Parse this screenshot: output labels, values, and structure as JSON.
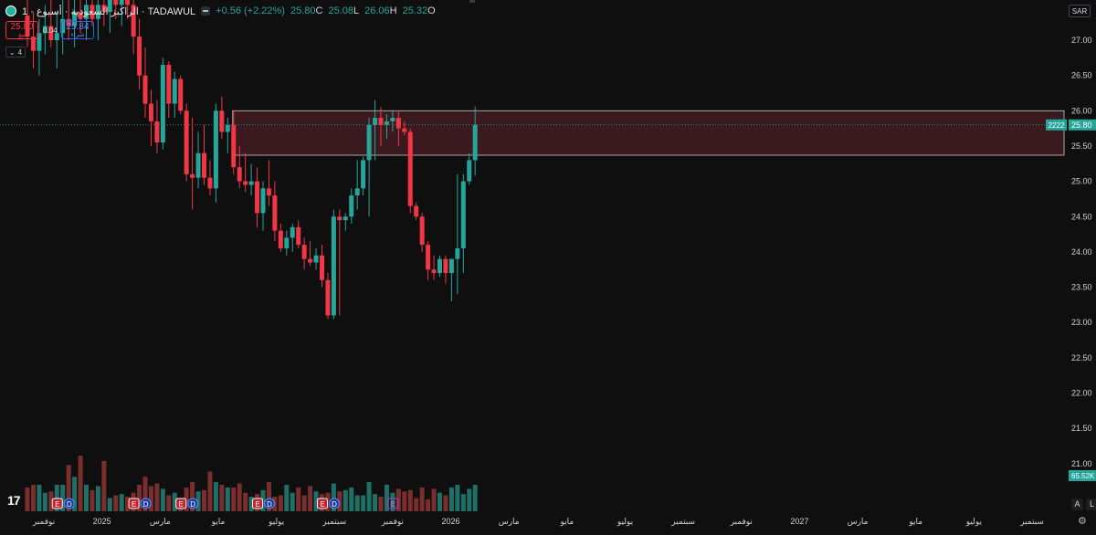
{
  "header": {
    "title": "الراكبز السعودية · أسبوع · 1 · TADAWUL",
    "change": "+0.56 (+2.22%)",
    "ohlc": [
      {
        "label": "O",
        "value": "25.32"
      },
      {
        "label": "H",
        "value": "26.06"
      },
      {
        "label": "L",
        "value": "25.08"
      },
      {
        "label": "C",
        "value": "25.80"
      }
    ]
  },
  "trade": {
    "sell_price": "25.80",
    "sell_label": "بيع",
    "buy_price": "25.84",
    "buy_label": "شراء",
    "spread": "0.04",
    "lots": "4"
  },
  "currency": "SAR",
  "bottom_buttons": {
    "auto": "A",
    "log": "L"
  },
  "colors": {
    "background": "#0f0f0f",
    "up": "#26a69a",
    "down": "#f23645",
    "up_volume": "#1f6f67",
    "down_volume": "#7a2e2e",
    "zone_fill": "#3a1a1e",
    "zone_border": "#c9c9c9",
    "current_price": "#26a69a"
  },
  "chart_data": {
    "type": "candlestick",
    "interval": "1 week",
    "y_axis": {
      "side": "right",
      "ticks": [
        "27.00",
        "26.50",
        "26.00",
        "25.50",
        "25.00",
        "24.50",
        "24.00",
        "23.50",
        "23.00",
        "22.50",
        "22.00",
        "21.50",
        "21.00"
      ],
      "range": [
        20.68,
        27.3
      ]
    },
    "x_axis_labels": [
      "نوفمبر",
      "2025",
      "مارس",
      "مايو",
      "يوليو",
      "سبتمبر",
      "نوفمبر",
      "2026",
      "مارس",
      "مايو",
      "يوليو",
      "سبتمبر",
      "نوفمبر",
      "2027",
      "مارس",
      "مايو",
      "يوليو",
      "سبتمبر"
    ],
    "current_price": "25.80",
    "countdown_badge": "2222",
    "last_volume_label": "65.52K",
    "resistance_zone": {
      "top": 26.0,
      "bottom": 25.37,
      "start_index": 35
    },
    "event_markers": [
      {
        "index": 5,
        "labels": [
          "E",
          "D"
        ]
      },
      {
        "index": 18,
        "labels": [
          "E",
          "D"
        ]
      },
      {
        "index": 26,
        "labels": [
          "E",
          "D"
        ]
      },
      {
        "index": 39,
        "labels": [
          "E",
          "D"
        ]
      },
      {
        "index": 50,
        "labels": [
          "E",
          "D"
        ]
      },
      {
        "index": 62,
        "labels": [
          "E"
        ]
      }
    ],
    "candles": [
      {
        "o": 27.35,
        "h": 27.6,
        "l": 26.9,
        "c": 27.05,
        "v": 0.18
      },
      {
        "o": 27.05,
        "h": 27.4,
        "l": 26.6,
        "c": 26.85,
        "v": 0.2
      },
      {
        "o": 26.85,
        "h": 27.3,
        "l": 26.5,
        "c": 27.1,
        "v": 0.2
      },
      {
        "o": 27.1,
        "h": 27.5,
        "l": 26.8,
        "c": 27.2,
        "v": 0.14
      },
      {
        "o": 27.2,
        "h": 27.6,
        "l": 26.9,
        "c": 27.0,
        "v": 0.15
      },
      {
        "o": 27.0,
        "h": 27.4,
        "l": 26.6,
        "c": 27.1,
        "v": 0.2
      },
      {
        "o": 27.1,
        "h": 27.6,
        "l": 26.8,
        "c": 27.3,
        "v": 0.2
      },
      {
        "o": 27.3,
        "h": 27.8,
        "l": 27.0,
        "c": 27.2,
        "v": 0.35
      },
      {
        "o": 27.2,
        "h": 27.6,
        "l": 26.9,
        "c": 27.4,
        "v": 0.26
      },
      {
        "o": 27.4,
        "h": 27.8,
        "l": 27.1,
        "c": 27.3,
        "v": 0.42
      },
      {
        "o": 27.3,
        "h": 27.7,
        "l": 27.0,
        "c": 27.5,
        "v": 0.2
      },
      {
        "o": 27.5,
        "h": 27.9,
        "l": 27.2,
        "c": 27.3,
        "v": 0.16
      },
      {
        "o": 27.3,
        "h": 27.7,
        "l": 27.0,
        "c": 27.5,
        "v": 0.19
      },
      {
        "o": 27.5,
        "h": 27.9,
        "l": 27.2,
        "c": 27.4,
        "v": 0.38
      },
      {
        "o": 27.4,
        "h": 27.8,
        "l": 27.1,
        "c": 27.6,
        "v": 0.1
      },
      {
        "o": 27.6,
        "h": 28.0,
        "l": 27.3,
        "c": 27.5,
        "v": 0.12
      },
      {
        "o": 27.5,
        "h": 27.9,
        "l": 27.2,
        "c": 27.7,
        "v": 0.13
      },
      {
        "o": 27.7,
        "h": 28.0,
        "l": 27.3,
        "c": 27.5,
        "v": 0.11
      },
      {
        "o": 27.5,
        "h": 27.9,
        "l": 26.8,
        "c": 27.05,
        "v": 0.14
      },
      {
        "o": 27.05,
        "h": 27.3,
        "l": 26.3,
        "c": 26.5,
        "v": 0.2
      },
      {
        "o": 26.5,
        "h": 26.9,
        "l": 25.9,
        "c": 26.1,
        "v": 0.26
      },
      {
        "o": 26.1,
        "h": 26.3,
        "l": 25.5,
        "c": 25.85,
        "v": 0.19
      },
      {
        "o": 25.85,
        "h": 26.15,
        "l": 25.4,
        "c": 25.55,
        "v": 0.21
      },
      {
        "o": 25.55,
        "h": 26.75,
        "l": 25.45,
        "c": 26.65,
        "v": 0.17
      },
      {
        "o": 26.65,
        "h": 26.7,
        "l": 25.9,
        "c": 26.1,
        "v": 0.12
      },
      {
        "o": 26.1,
        "h": 26.55,
        "l": 25.9,
        "c": 26.45,
        "v": 0.14
      },
      {
        "o": 26.45,
        "h": 26.5,
        "l": 25.95,
        "c": 26.0,
        "v": 0.08
      },
      {
        "o": 26.0,
        "h": 26.1,
        "l": 25.0,
        "c": 25.1,
        "v": 0.18
      },
      {
        "o": 25.1,
        "h": 25.9,
        "l": 24.6,
        "c": 25.05,
        "v": 0.22
      },
      {
        "o": 25.05,
        "h": 25.7,
        "l": 24.9,
        "c": 25.4,
        "v": 0.15
      },
      {
        "o": 25.4,
        "h": 25.8,
        "l": 24.95,
        "c": 25.05,
        "v": 0.16
      },
      {
        "o": 25.05,
        "h": 25.3,
        "l": 24.8,
        "c": 24.9,
        "v": 0.3
      },
      {
        "o": 24.9,
        "h": 26.1,
        "l": 24.7,
        "c": 26.0,
        "v": 0.22
      },
      {
        "o": 26.0,
        "h": 26.2,
        "l": 25.6,
        "c": 25.7,
        "v": 0.2
      },
      {
        "o": 25.7,
        "h": 25.9,
        "l": 25.4,
        "c": 25.8,
        "v": 0.18
      },
      {
        "o": 25.8,
        "h": 26.0,
        "l": 25.1,
        "c": 25.2,
        "v": 0.18
      },
      {
        "o": 25.2,
        "h": 25.5,
        "l": 24.9,
        "c": 25.0,
        "v": 0.21
      },
      {
        "o": 25.0,
        "h": 25.4,
        "l": 24.85,
        "c": 24.95,
        "v": 0.14
      },
      {
        "o": 24.95,
        "h": 25.25,
        "l": 24.8,
        "c": 25.0,
        "v": 0.11
      },
      {
        "o": 25.0,
        "h": 25.2,
        "l": 24.35,
        "c": 24.55,
        "v": 0.13
      },
      {
        "o": 24.55,
        "h": 25.0,
        "l": 24.3,
        "c": 24.9,
        "v": 0.16
      },
      {
        "o": 24.9,
        "h": 25.3,
        "l": 24.65,
        "c": 24.8,
        "v": 0.22
      },
      {
        "o": 24.8,
        "h": 25.0,
        "l": 24.15,
        "c": 24.3,
        "v": 0.11
      },
      {
        "o": 24.3,
        "h": 24.4,
        "l": 24.0,
        "c": 24.05,
        "v": 0.12
      },
      {
        "o": 24.05,
        "h": 24.3,
        "l": 23.95,
        "c": 24.2,
        "v": 0.2
      },
      {
        "o": 24.2,
        "h": 24.4,
        "l": 24.0,
        "c": 24.35,
        "v": 0.14
      },
      {
        "o": 24.35,
        "h": 24.45,
        "l": 24.05,
        "c": 24.1,
        "v": 0.18
      },
      {
        "o": 24.1,
        "h": 24.2,
        "l": 23.75,
        "c": 23.9,
        "v": 0.12
      },
      {
        "o": 23.9,
        "h": 24.15,
        "l": 23.8,
        "c": 23.85,
        "v": 0.19
      },
      {
        "o": 23.85,
        "h": 24.05,
        "l": 23.75,
        "c": 23.95,
        "v": 0.15
      },
      {
        "o": 23.95,
        "h": 24.1,
        "l": 23.5,
        "c": 23.6,
        "v": 0.13
      },
      {
        "o": 23.6,
        "h": 23.7,
        "l": 23.05,
        "c": 23.1,
        "v": 0.14
      },
      {
        "o": 23.1,
        "h": 24.6,
        "l": 23.05,
        "c": 24.5,
        "v": 0.21
      },
      {
        "o": 24.5,
        "h": 24.6,
        "l": 23.1,
        "c": 24.45,
        "v": 0.15
      },
      {
        "o": 24.45,
        "h": 24.55,
        "l": 24.3,
        "c": 24.5,
        "v": 0.16
      },
      {
        "o": 24.5,
        "h": 24.9,
        "l": 24.4,
        "c": 24.8,
        "v": 0.18
      },
      {
        "o": 24.8,
        "h": 25.3,
        "l": 24.6,
        "c": 24.9,
        "v": 0.12
      },
      {
        "o": 24.9,
        "h": 25.35,
        "l": 24.8,
        "c": 25.3,
        "v": 0.12
      },
      {
        "o": 25.3,
        "h": 25.9,
        "l": 24.5,
        "c": 25.8,
        "v": 0.22
      },
      {
        "o": 25.8,
        "h": 26.15,
        "l": 25.3,
        "c": 25.9,
        "v": 0.13
      },
      {
        "o": 25.9,
        "h": 26.05,
        "l": 25.5,
        "c": 25.8,
        "v": 0.11
      },
      {
        "o": 25.8,
        "h": 25.95,
        "l": 25.6,
        "c": 25.85,
        "v": 0.2
      },
      {
        "o": 25.85,
        "h": 26.0,
        "l": 25.7,
        "c": 25.9,
        "v": 0.14
      },
      {
        "o": 25.9,
        "h": 26.0,
        "l": 25.5,
        "c": 25.75,
        "v": 0.17
      },
      {
        "o": 25.75,
        "h": 25.85,
        "l": 25.65,
        "c": 25.7,
        "v": 0.15
      },
      {
        "o": 25.7,
        "h": 25.75,
        "l": 24.55,
        "c": 24.65,
        "v": 0.16
      },
      {
        "o": 24.65,
        "h": 24.7,
        "l": 24.45,
        "c": 24.5,
        "v": 0.1
      },
      {
        "o": 24.5,
        "h": 24.55,
        "l": 24.0,
        "c": 24.1,
        "v": 0.18
      },
      {
        "o": 24.1,
        "h": 24.15,
        "l": 23.6,
        "c": 23.75,
        "v": 0.09
      },
      {
        "o": 23.75,
        "h": 23.95,
        "l": 23.6,
        "c": 23.7,
        "v": 0.17
      },
      {
        "o": 23.7,
        "h": 23.95,
        "l": 23.65,
        "c": 23.9,
        "v": 0.14
      },
      {
        "o": 23.9,
        "h": 23.95,
        "l": 23.55,
        "c": 23.7,
        "v": 0.12
      },
      {
        "o": 23.7,
        "h": 23.9,
        "l": 23.3,
        "c": 23.9,
        "v": 0.18
      },
      {
        "o": 23.9,
        "h": 25.1,
        "l": 23.4,
        "c": 24.05,
        "v": 0.2
      },
      {
        "o": 24.05,
        "h": 25.1,
        "l": 23.7,
        "c": 25.0,
        "v": 0.13
      },
      {
        "o": 25.0,
        "h": 25.4,
        "l": 24.95,
        "c": 25.3,
        "v": 0.17
      },
      {
        "o": 25.3,
        "h": 26.06,
        "l": 25.08,
        "c": 25.8,
        "v": 0.2
      }
    ]
  }
}
